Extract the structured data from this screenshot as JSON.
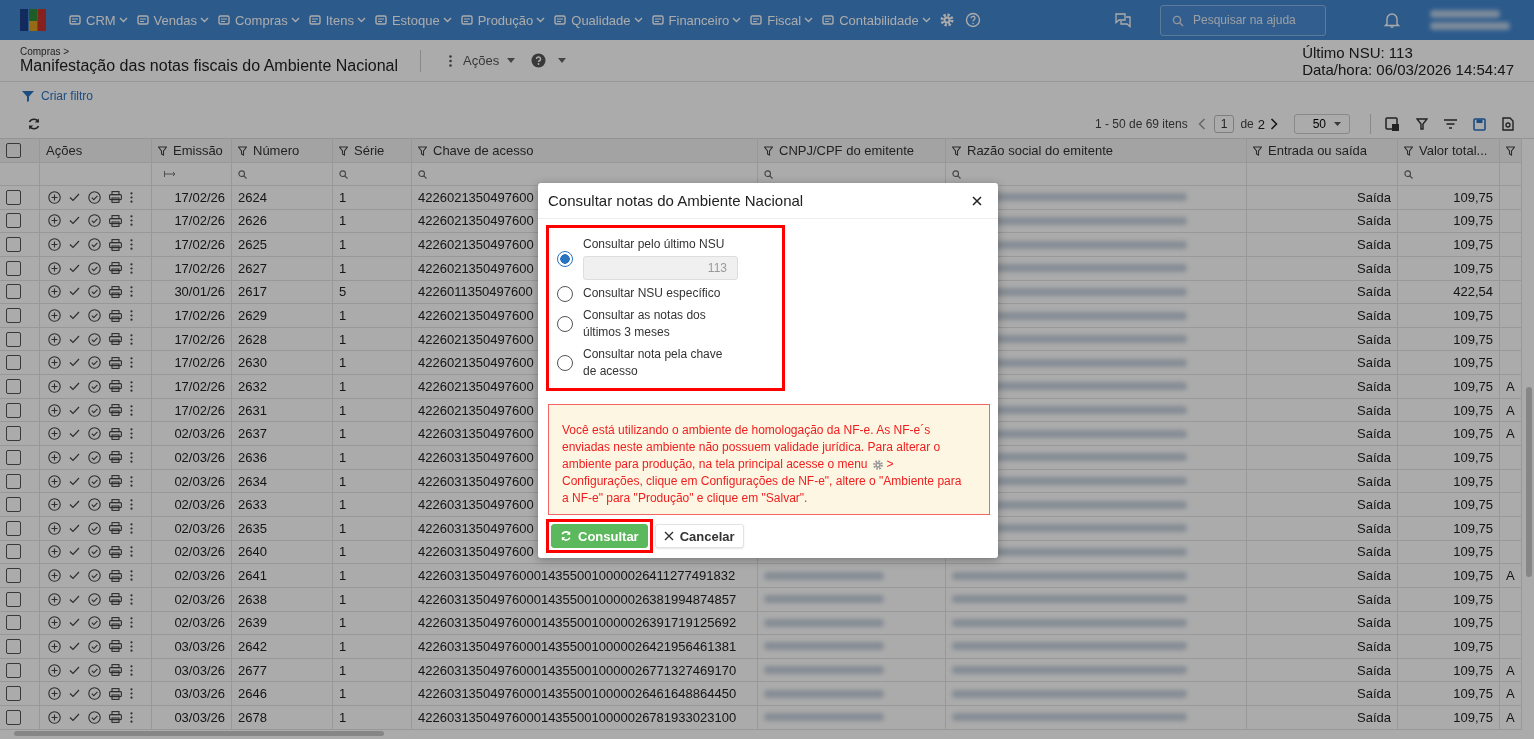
{
  "navbar": {
    "menus": [
      {
        "label": "CRM"
      },
      {
        "label": "Vendas"
      },
      {
        "label": "Compras"
      },
      {
        "label": "Itens"
      },
      {
        "label": "Estoque"
      },
      {
        "label": "Produção"
      },
      {
        "label": "Qualidade"
      },
      {
        "label": "Financeiro"
      },
      {
        "label": "Fiscal"
      },
      {
        "label": "Contabilidade"
      }
    ],
    "search": {
      "placeholder": "Pesquisar na ajuda"
    }
  },
  "header": {
    "breadcrumb": "Compras >",
    "title": "Manifestação das notas fiscais do Ambiente Nacional",
    "actions_label": "Ações",
    "last_nsu": "Último NSU: 113",
    "datetime": "Data/hora: 06/03/2026 14:54:47"
  },
  "filter_link": "Criar filtro",
  "pagination": {
    "range": "1 - 50 de 69 itens",
    "page": "1",
    "of": "de",
    "pages": "2",
    "page_size": "50"
  },
  "table": {
    "all_checked": false,
    "columns": [
      {
        "label": "Ações",
        "kind": "actions"
      },
      {
        "label": "Emissão",
        "kind": "date"
      },
      {
        "label": "Número",
        "kind": "searchable"
      },
      {
        "label": "Série",
        "kind": "searchable"
      },
      {
        "label": "Chave de acesso",
        "kind": "searchable"
      },
      {
        "label": "CNPJ/CPF do emitente",
        "kind": "searchable"
      },
      {
        "label": "Razão social do emitente",
        "kind": "searchable"
      },
      {
        "label": "Entrada ou saída",
        "kind": "select"
      },
      {
        "label": "Valor total...",
        "kind": "searchable"
      },
      {
        "kind": "select"
      }
    ],
    "rows": [
      {
        "checked": false,
        "emissao": "17/02/26",
        "numero": "2624",
        "serie": "1",
        "chave": "4226021350497600",
        "tipo": "Saída",
        "valor": "109,75"
      },
      {
        "checked": false,
        "emissao": "17/02/26",
        "numero": "2626",
        "serie": "1",
        "chave": "4226021350497600",
        "tipo": "Saída",
        "valor": "109,75"
      },
      {
        "checked": false,
        "emissao": "17/02/26",
        "numero": "2625",
        "serie": "1",
        "chave": "4226021350497600",
        "tipo": "Saída",
        "valor": "109,75"
      },
      {
        "checked": false,
        "emissao": "17/02/26",
        "numero": "2627",
        "serie": "1",
        "chave": "4226021350497600",
        "tipo": "Saída",
        "valor": "109,75"
      },
      {
        "checked": false,
        "emissao": "30/01/26",
        "numero": "2617",
        "serie": "5",
        "chave": "4226011350497600",
        "tipo": "Saída",
        "valor": "422,54"
      },
      {
        "checked": false,
        "emissao": "17/02/26",
        "numero": "2629",
        "serie": "1",
        "chave": "4226021350497600",
        "tipo": "Saída",
        "valor": "109,75"
      },
      {
        "checked": false,
        "emissao": "17/02/26",
        "numero": "2628",
        "serie": "1",
        "chave": "4226021350497600",
        "tipo": "Saída",
        "valor": "109,75"
      },
      {
        "checked": false,
        "emissao": "17/02/26",
        "numero": "2630",
        "serie": "1",
        "chave": "4226021350497600",
        "tipo": "Saída",
        "valor": "109,75"
      },
      {
        "checked": false,
        "emissao": "17/02/26",
        "numero": "2632",
        "serie": "1",
        "chave": "4226021350497600",
        "tipo": "Saída",
        "valor": "109,75",
        "column_10": "A"
      },
      {
        "checked": false,
        "emissao": "17/02/26",
        "numero": "2631",
        "serie": "1",
        "chave": "4226021350497600",
        "tipo": "Saída",
        "valor": "109,75",
        "column_10": "A"
      },
      {
        "checked": false,
        "emissao": "02/03/26",
        "numero": "2637",
        "serie": "1",
        "chave": "4226031350497600",
        "tipo": "Saída",
        "valor": "109,75",
        "column_10": "A"
      },
      {
        "checked": false,
        "emissao": "02/03/26",
        "numero": "2636",
        "serie": "1",
        "chave": "4226031350497600",
        "tipo": "Saída",
        "valor": "109,75"
      },
      {
        "checked": false,
        "emissao": "02/03/26",
        "numero": "2634",
        "serie": "1",
        "chave": "4226031350497600",
        "tipo": "Saída",
        "valor": "109,75"
      },
      {
        "checked": false,
        "emissao": "02/03/26",
        "numero": "2633",
        "serie": "1",
        "chave": "4226031350497600",
        "tipo": "Saída",
        "valor": "109,75"
      },
      {
        "checked": false,
        "emissao": "02/03/26",
        "numero": "2635",
        "serie": "1",
        "chave": "4226031350497600",
        "tipo": "Saída",
        "valor": "109,75"
      },
      {
        "checked": false,
        "emissao": "02/03/26",
        "numero": "2640",
        "serie": "1",
        "chave": "4226031350497600",
        "tipo": "Saída",
        "valor": "109,75"
      },
      {
        "checked": false,
        "emissao": "02/03/26",
        "numero": "2641",
        "serie": "1",
        "chave": "42260313504976000143550010000026411277491832",
        "tipo": "Saída",
        "valor": "109,75",
        "column_10": "A"
      },
      {
        "checked": false,
        "emissao": "02/03/26",
        "numero": "2638",
        "serie": "1",
        "chave": "42260313504976000143550010000026381994874857",
        "tipo": "Saída",
        "valor": "109,75"
      },
      {
        "checked": false,
        "emissao": "02/03/26",
        "numero": "2639",
        "serie": "1",
        "chave": "42260313504976000143550010000026391719125692",
        "tipo": "Saída",
        "valor": "109,75"
      },
      {
        "checked": false,
        "emissao": "03/03/26",
        "numero": "2642",
        "serie": "1",
        "chave": "42260313504976000143550010000026421956461381",
        "tipo": "Saída",
        "valor": "109,75"
      },
      {
        "checked": false,
        "emissao": "03/03/26",
        "numero": "2677",
        "serie": "1",
        "chave": "42260313504976000143550010000026771327469170",
        "tipo": "Saída",
        "valor": "109,75",
        "column_10": "A"
      },
      {
        "checked": false,
        "emissao": "03/03/26",
        "numero": "2646",
        "serie": "1",
        "chave": "42260313504976000143550010000026461648864450",
        "tipo": "Saída",
        "valor": "109,75",
        "column_10": "A"
      },
      {
        "checked": false,
        "emissao": "03/03/26",
        "numero": "2678",
        "serie": "1",
        "chave": "42260313504976000143550010000026781933023100",
        "tipo": "Saída",
        "valor": "109,75",
        "column_10": "A"
      }
    ]
  },
  "dialog": {
    "title": "Consultar notas do Ambiente Nacional",
    "options": [
      {
        "label": "Consultar pelo último NSU",
        "selected": true,
        "input": {
          "value": "113",
          "disabled": true
        }
      },
      {
        "label": "Consultar NSU específico",
        "selected": false
      },
      {
        "label": "Consultar as notas dos últimos 3 meses",
        "selected": false
      },
      {
        "label": "Consultar nota pela chave de acesso",
        "selected": false
      }
    ],
    "warning_start": "Você está utilizando o ambiente de homologação da NF-e. As NF-e´s enviadas neste ambiente não possuem validade jurídica. Para alterar o",
    "warning_before_icon": "ambiente para produção, na tela principal acesse o menu",
    "warning_after_icon": ">",
    "warning_end": "Configurações, clique em Configurações de NF-e\", altere o \"Ambiente para a NF-e\" para \"Produção\" e clique em \"Salvar\".",
    "buttons": [
      {
        "label": "Consultar",
        "kind": "primary"
      },
      {
        "label": "Cancelar",
        "kind": "cancel"
      }
    ]
  }
}
